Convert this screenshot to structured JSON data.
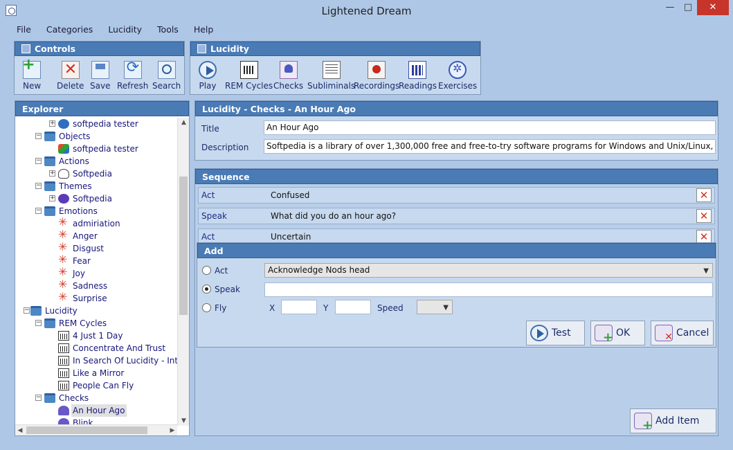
{
  "window": {
    "title": "Lightened Dream",
    "minimize": "—",
    "maximize": "□",
    "close": "✕"
  },
  "menu": [
    "File",
    "Categories",
    "Lucidity",
    "Tools",
    "Help"
  ],
  "controls": {
    "title": "Controls",
    "tools": [
      "New",
      "Delete",
      "Save",
      "Refresh",
      "Search"
    ]
  },
  "lucidity_toolbar": {
    "title": "Lucidity",
    "tools": [
      "Play",
      "REM Cycles",
      "Checks",
      "Subliminals",
      "Recordings",
      "Readings",
      "Exercises"
    ]
  },
  "explorer": {
    "title": "Explorer",
    "rows": [
      {
        "label": "softpedia tester",
        "depth": 2,
        "icon": "globe-icon",
        "expander": "+"
      },
      {
        "label": "Objects",
        "depth": 1,
        "icon": "folder-icon",
        "expander": "−"
      },
      {
        "label": "softpedia tester",
        "depth": 2,
        "icon": "objects-icon",
        "expander": ""
      },
      {
        "label": "Actions",
        "depth": 1,
        "icon": "folder-icon",
        "expander": "−"
      },
      {
        "label": "Softpedia",
        "depth": 2,
        "icon": "action-icon",
        "expander": "+"
      },
      {
        "label": "Themes",
        "depth": 1,
        "icon": "folder-icon",
        "expander": "−"
      },
      {
        "label": "Softpedia",
        "depth": 2,
        "icon": "theme-icon",
        "expander": "+"
      },
      {
        "label": "Emotions",
        "depth": 1,
        "icon": "folder-icon",
        "expander": "−"
      },
      {
        "label": "admiriation",
        "depth": 2,
        "icon": "emotion-icon",
        "expander": ""
      },
      {
        "label": "Anger",
        "depth": 2,
        "icon": "emotion-icon",
        "expander": ""
      },
      {
        "label": "Disgust",
        "depth": 2,
        "icon": "emotion-icon",
        "expander": ""
      },
      {
        "label": "Fear",
        "depth": 2,
        "icon": "emotion-icon",
        "expander": ""
      },
      {
        "label": "Joy",
        "depth": 2,
        "icon": "emotion-icon",
        "expander": ""
      },
      {
        "label": "Sadness",
        "depth": 2,
        "icon": "emotion-icon",
        "expander": ""
      },
      {
        "label": "Surprise",
        "depth": 2,
        "icon": "emotion-icon",
        "expander": ""
      },
      {
        "label": "Lucidity",
        "depth": 0,
        "icon": "folder-icon",
        "expander": "−"
      },
      {
        "label": "REM Cycles",
        "depth": 1,
        "icon": "folder-icon",
        "expander": "−"
      },
      {
        "label": "4 Just 1 Day",
        "depth": 2,
        "icon": "rem-cycle-icon",
        "expander": ""
      },
      {
        "label": "Concentrate And Trust",
        "depth": 2,
        "icon": "rem-cycle-icon",
        "expander": ""
      },
      {
        "label": "In Search Of Lucidity - Intr",
        "depth": 2,
        "icon": "rem-cycle-icon",
        "expander": ""
      },
      {
        "label": "Like a Mirror",
        "depth": 2,
        "icon": "rem-cycle-icon",
        "expander": ""
      },
      {
        "label": "People Can Fly",
        "depth": 2,
        "icon": "rem-cycle-icon",
        "expander": ""
      },
      {
        "label": "Checks",
        "depth": 1,
        "icon": "folder-icon",
        "expander": "−"
      },
      {
        "label": "An Hour Ago",
        "depth": 2,
        "icon": "check-icon",
        "expander": "",
        "selected": true
      },
      {
        "label": "Blink",
        "depth": 2,
        "icon": "check-icon",
        "expander": ""
      }
    ]
  },
  "detail": {
    "title": "Lucidity - Checks - An Hour Ago",
    "title_label": "Title",
    "title_value": "An Hour Ago",
    "description_label": "Description",
    "description_value": "Softpedia is a library of over 1,300,000 free and free-to-try software programs for Windows and Unix/Linux, gam"
  },
  "sequence": {
    "title": "Sequence",
    "rows": [
      {
        "kind": "Act",
        "text": "Confused"
      },
      {
        "kind": "Speak",
        "text": "What did you do an hour ago?"
      },
      {
        "kind": "Act",
        "text": "Uncertain"
      }
    ],
    "add_item": "Add Item"
  },
  "add": {
    "title": "Add",
    "act_label": "Act",
    "act_value": "Acknowledge Nods head",
    "speak_label": "Speak",
    "speak_value": "",
    "fly_label": "Fly",
    "x_label": "X",
    "y_label": "Y",
    "speed_label": "Speed",
    "selected_option": "Speak",
    "test_button": "Test",
    "ok_button": "OK",
    "cancel_button": "Cancel"
  }
}
